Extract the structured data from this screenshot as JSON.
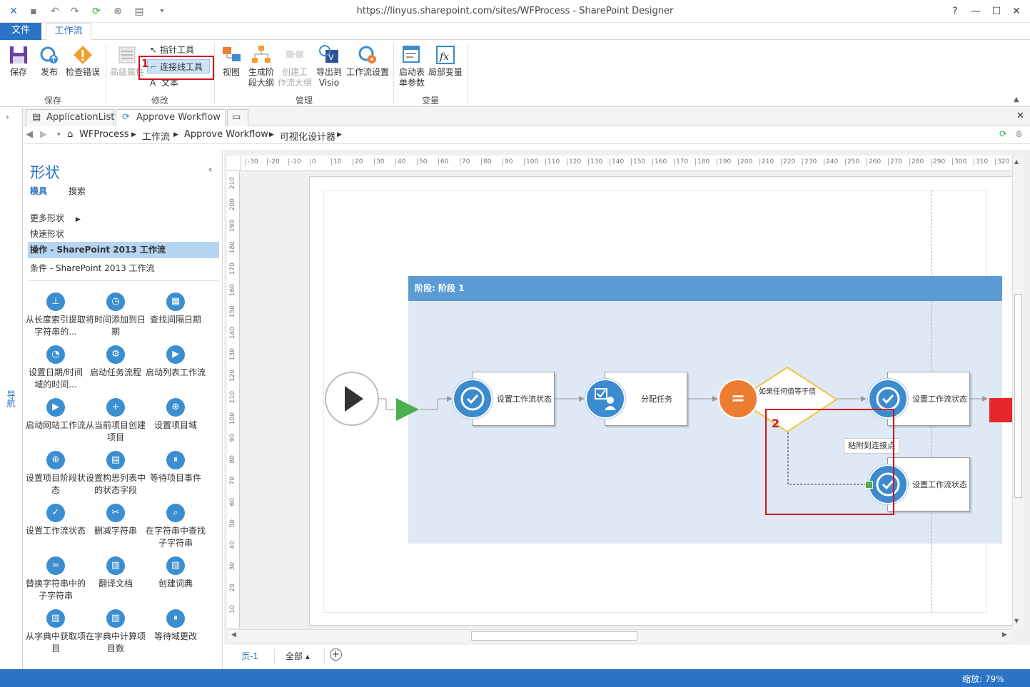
{
  "window": {
    "title": "https://linyus.sharepoint.com/sites/WFProcess - SharePoint Designer",
    "help": "?",
    "minimize": "—",
    "maximize": "☐",
    "close": "✕"
  },
  "ribbon_tabs": {
    "file": "文件",
    "workflow": "工作流"
  },
  "ribbon": {
    "save": "保存",
    "publish": "发布",
    "check_errors": "检查错误",
    "advanced_properties": "高级属性",
    "pointer_tool": "指针工具",
    "connector_tool": "连接线工具",
    "text_tool": "文本",
    "view": "视图",
    "generate_stage_outline_1": "生成阶",
    "generate_stage_outline_2": "段大纲",
    "create_workflow_outline_1": "创建工",
    "create_workflow_outline_2": "作流大纲",
    "export_visio_1": "导出到",
    "export_visio_2": "Visio",
    "workflow_settings": "工作流设置",
    "init_form_params_1": "启动表",
    "init_form_params_2": "单参数",
    "local_variables": "局部变量",
    "groups": {
      "save": "保存",
      "modify": "修改",
      "manage": "管理",
      "variables": "变量"
    }
  },
  "annotations": {
    "marker1": "1",
    "marker2": "2"
  },
  "doc_tabs": {
    "tab1": "ApplicationList",
    "tab2": "Approve Workflow *"
  },
  "breadcrumb": {
    "site": "WFProcess",
    "workflows": "工作流",
    "workflow": "Approve Workflow",
    "designer": "可视化设计器"
  },
  "nav_label": "导航",
  "shapes_pane": {
    "title": "形状",
    "tab_stencils": "模具",
    "tab_search": "搜索",
    "more_shapes": "更多形状",
    "quick_shapes": "快速形状",
    "actions_category": "操作 - SharePoint 2013 工作流",
    "conditions_category": "条件 - SharePoint 2013 工作流",
    "items": [
      "从长度索引提取字符串的...",
      "将时间添加到日期",
      "查找间隔日期",
      "设置日期/时间域的时间...",
      "启动任务流程",
      "启动列表工作流",
      "启动网站工作流",
      "从当前项目创建项目",
      "设置项目域",
      "设置项目阶段状态",
      "设置构思列表中的状态字段",
      "等待项目事件",
      "设置工作流状态",
      "删减字符串",
      "在字符串中查找子字符串",
      "替换字符串中的子字符串",
      "翻译文档",
      "创建词典",
      "从字典中获取项目",
      "在字典中计算项目数",
      "等待域更改"
    ]
  },
  "canvas": {
    "stage_title": "阶段: 阶段 1",
    "action1": "设置工作流状态",
    "action2": "分配任务",
    "condition": "如果任何值等于值",
    "action3": "设置工作流状态",
    "action4": "设置工作流状态",
    "tooltip": "粘附到连接点",
    "ruler_top_labels": [
      "-30",
      "-20",
      "-10",
      "0",
      "10",
      "20",
      "30",
      "40",
      "50",
      "60",
      "70",
      "80",
      "90",
      "100",
      "110",
      "120",
      "130",
      "140",
      "150",
      "160",
      "170",
      "180",
      "190",
      "200",
      "210",
      "220",
      "230",
      "240",
      "250",
      "260",
      "270",
      "280",
      "290",
      "300",
      "310",
      "320"
    ],
    "ruler_left_labels": [
      "210",
      "200",
      "190",
      "180",
      "170",
      "160",
      "150",
      "140",
      "130",
      "120",
      "110",
      "100",
      "90",
      "80",
      "70",
      "60",
      "50",
      "40",
      "30",
      "20",
      "10"
    ]
  },
  "page_tabs": {
    "page1": "页-1",
    "all": "全部 ▴"
  },
  "status": {
    "zoom": "缩放: 79%"
  },
  "colors": {
    "accent": "#2b73c4",
    "stage_header": "#5b9bd5",
    "stage_body": "#dfe9f5",
    "action_circle": "#3c8bcf",
    "condition_circle": "#ed7d31",
    "condition_diamond": "#f5c342",
    "start_arrow": "#4caf50",
    "end_square": "#e8272a",
    "annotation_red": "#d0121b"
  }
}
